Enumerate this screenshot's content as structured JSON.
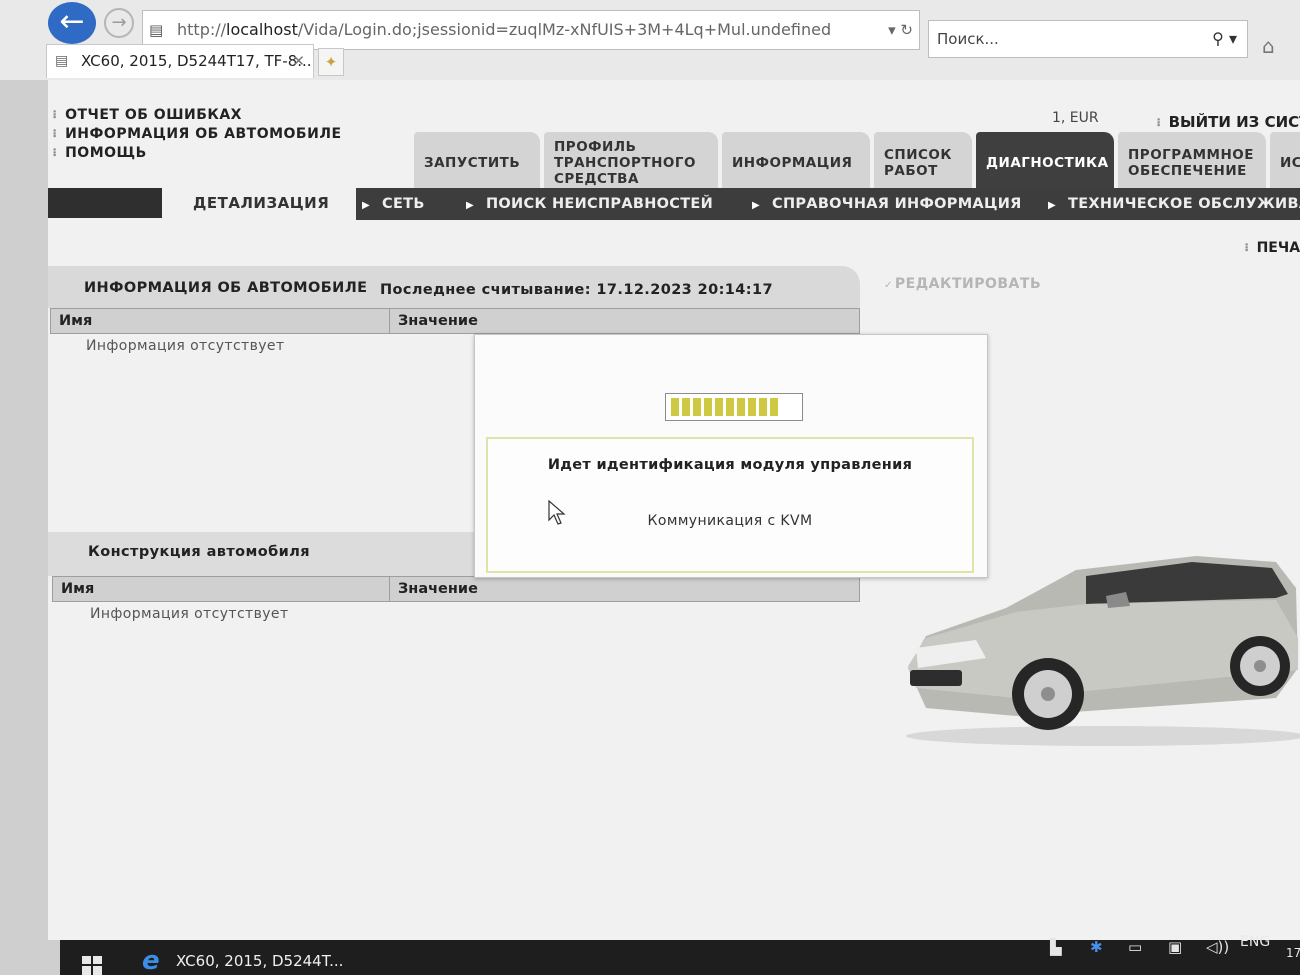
{
  "browser": {
    "url_prefix": "http://",
    "url_host": "localhost",
    "url_rest": "/Vida/Login.do;jsessionid=zuqlMz-xNfUIS+3M+4Lq+Mul.undefined",
    "search_placeholder": "Поиск...",
    "tab_title": "XC60, 2015, D5244T17, TF-8..."
  },
  "header": {
    "links": [
      "ОТЧЕТ ОБ ОШИБКАХ",
      "ИНФОРМАЦИЯ ОБ АВТОМОБИЛЕ",
      "ПОМОЩЬ"
    ],
    "currency": "1, EUR",
    "logout": "ВЫЙТИ ИЗ СИСТ"
  },
  "main_tabs": [
    {
      "label": "ЗАПУСТИТЬ",
      "active": false
    },
    {
      "label": "ПРОФИЛЬ ТРАНСПОРТНОГО СРЕДСТВА",
      "active": false
    },
    {
      "label": "ИНФОРМАЦИЯ",
      "active": false
    },
    {
      "label": "СПИСОК РАБОТ",
      "active": false
    },
    {
      "label": "ДИАГНОСТИКА",
      "active": true
    },
    {
      "label": "ПРОГРАММНОЕ ОБЕСПЕЧЕНИЕ",
      "active": false
    },
    {
      "label": "ИС",
      "active": false
    }
  ],
  "subnav": {
    "detail": "ДЕТАЛИЗАЦИЯ",
    "items": [
      "СЕТЬ",
      "ПОИСК НЕИСПРАВНОСТЕЙ",
      "СПРАВОЧНАЯ ИНФОРМАЦИЯ",
      "ТЕХНИЧЕСКОЕ ОБСЛУЖИВАН"
    ],
    "print": "ПЕЧА"
  },
  "vehicle_info": {
    "title": "ИНФОРМАЦИЯ ОБ АВТОМОБИЛЕ",
    "last_read": "Последнее считывание: 17.12.2023 20:14:17",
    "edit": "РЕДАКТИРОВАТЬ",
    "col_name": "Имя",
    "col_value": "Значение",
    "empty": "Информация отсутствует"
  },
  "construction": {
    "title": "Конструкция автомобиля",
    "col_name": "Имя",
    "col_value": "Значение",
    "empty": "Информация отсутствует"
  },
  "dialog": {
    "title": "Идет идентификация модуля управления",
    "status": "Коммуникация с KVM",
    "progress_segments": 10
  },
  "taskbar": {
    "app": "XC60, 2015, D5244T...",
    "lang": "ENG",
    "clock": "17"
  },
  "colors": {
    "active_tab": "#3f3f3f",
    "progress": "#cfc843",
    "browser_back": "#2f6bc4"
  }
}
